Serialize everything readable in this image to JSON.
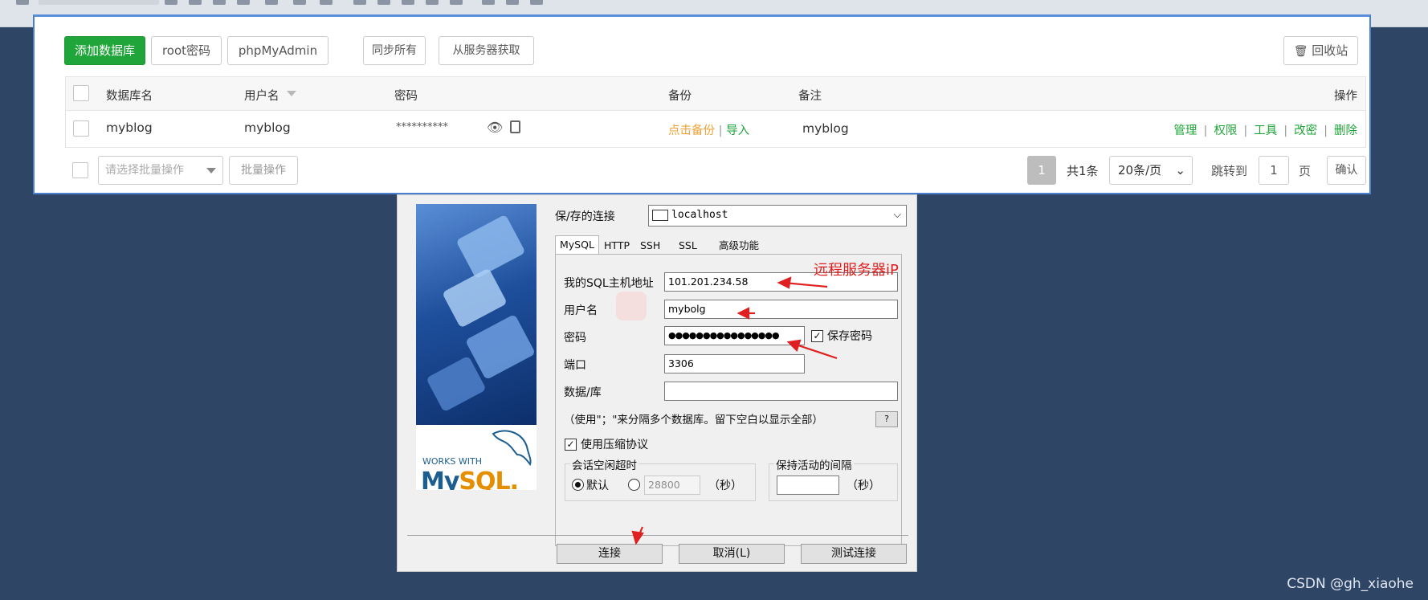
{
  "panel": {
    "toolbar": {
      "add_db": "添加数据库",
      "root_pwd": "root密码",
      "phpmyadmin": "phpMyAdmin",
      "sync_all": "同步所有",
      "fetch_server": "从服务器获取",
      "recycle": "回收站"
    },
    "columns": {
      "name": "数据库名",
      "user": "用户名",
      "password": "密码",
      "backup": "备份",
      "note": "备注",
      "actions": "操作"
    },
    "rows": [
      {
        "name": "myblog",
        "user": "myblog",
        "password": "**********",
        "backup_link": "点击备份",
        "import_link": "导入",
        "note": "myblog",
        "actions": [
          "管理",
          "权限",
          "工具",
          "改密",
          "删除"
        ]
      }
    ],
    "footer": {
      "batch_placeholder": "请选择批量操作",
      "batch_button": "批量操作",
      "page_current": "1",
      "total": "共1条",
      "per_page": "20条/页",
      "jump_label": "跳转到",
      "jump_value": "1",
      "page_unit": "页",
      "confirm": "确认"
    }
  },
  "dialog": {
    "saved_conn_label": "保/存的连接",
    "saved_conn_value": "localhost",
    "tabs": [
      "MySQL",
      "HTTP",
      "SSH",
      "SSL",
      "高级功能"
    ],
    "host_label": "我的SQL主机地址",
    "host_value": "101.201.234.58",
    "user_label": "用户名",
    "user_value": "mybolg",
    "password_label": "密码",
    "password_value": "●●●●●●●●●●●●●●●●",
    "save_password_label": "保存密码",
    "port_label": "端口",
    "port_value": "3306",
    "database_label": "数据/库",
    "database_value": "",
    "hint": "（使用\"；\"来分隔多个数据库。留下空白以显示全部）",
    "help": "?",
    "compress_label": "使用压缩协议",
    "session_group": "会话空闲超时",
    "default_label": "默认",
    "timeout_value": "28800",
    "seconds": "（秒）",
    "keepalive_group": "保持活动的间隔",
    "keepalive_value": "",
    "connect": "连接",
    "cancel": "取消(L)",
    "test": "测试连接",
    "banner_works": "WORKS WITH",
    "banner_my": "My",
    "banner_sql": "SQL."
  },
  "annotation": {
    "remote_ip": "远程服务器iP"
  },
  "watermark": "CSDN @gh_xiaohe"
}
